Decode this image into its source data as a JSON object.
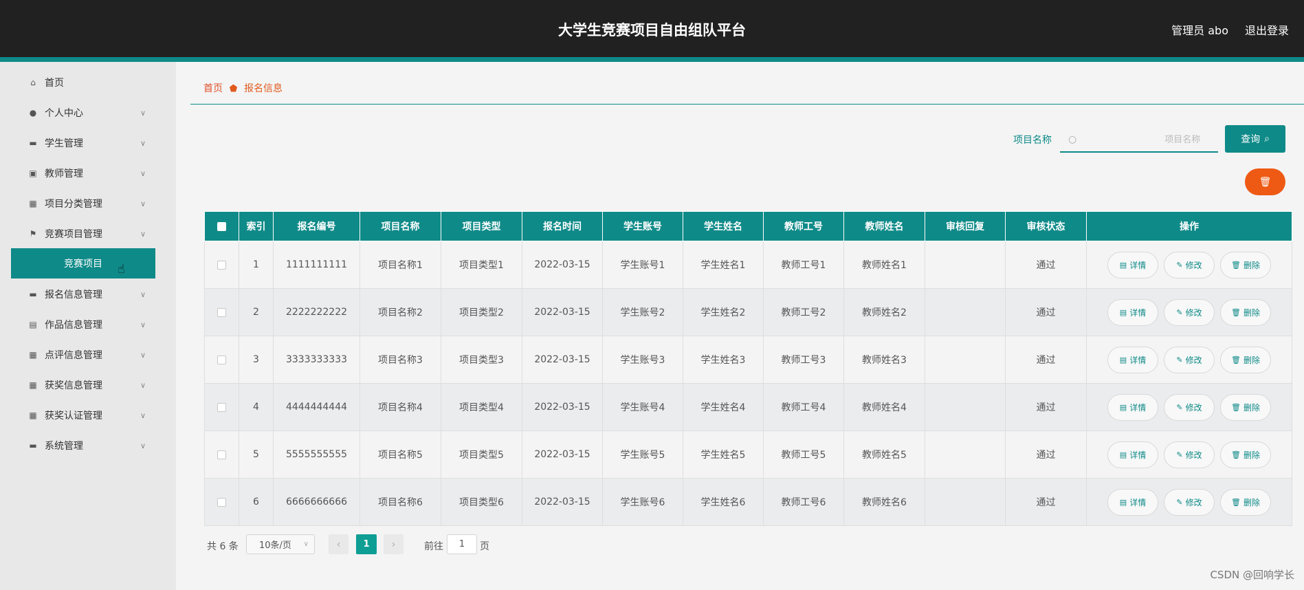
{
  "header": {
    "title": "大学生竞赛项目自由组队平台",
    "user": "管理员 abo",
    "logout": "退出登录"
  },
  "sidebar": {
    "items": [
      {
        "label": "首页",
        "icon": "home-icon",
        "glyph": "⌂",
        "arrow": false
      },
      {
        "label": "个人中心",
        "icon": "user-icon",
        "glyph": "●",
        "arrow": true
      },
      {
        "label": "学生管理",
        "icon": "briefcase-icon",
        "glyph": "▬",
        "arrow": true
      },
      {
        "label": "教师管理",
        "icon": "clipboard-icon",
        "glyph": "▣",
        "arrow": true
      },
      {
        "label": "项目分类管理",
        "icon": "grid-icon",
        "glyph": "▦",
        "arrow": true
      },
      {
        "label": "竞赛项目管理",
        "icon": "flag-icon",
        "glyph": "⚑",
        "arrow": true
      },
      {
        "label": "报名信息管理",
        "icon": "ticket-icon",
        "glyph": "▬",
        "arrow": true
      },
      {
        "label": "作品信息管理",
        "icon": "document-icon",
        "glyph": "▤",
        "arrow": true
      },
      {
        "label": "点评信息管理",
        "icon": "grid-icon",
        "glyph": "▦",
        "arrow": true
      },
      {
        "label": "获奖信息管理",
        "icon": "grid-icon",
        "glyph": "▦",
        "arrow": true
      },
      {
        "label": "获奖认证管理",
        "icon": "apps-icon",
        "glyph": "▦",
        "arrow": true
      },
      {
        "label": "系统管理",
        "icon": "monitor-icon",
        "glyph": "▬",
        "arrow": true
      }
    ],
    "active_sub": "竞赛项目"
  },
  "breadcrumb": {
    "home": "首页",
    "current": "报名信息"
  },
  "search": {
    "label": "项目名称",
    "placeholder": "项目名称",
    "button": "查询"
  },
  "table": {
    "headers": [
      "索引",
      "报名编号",
      "项目名称",
      "项目类型",
      "报名时间",
      "学生账号",
      "学生姓名",
      "教师工号",
      "教师姓名",
      "审核回复",
      "审核状态",
      "操作"
    ],
    "rows": [
      [
        "1",
        "1111111111",
        "项目名称1",
        "项目类型1",
        "2022-03-15",
        "学生账号1",
        "学生姓名1",
        "教师工号1",
        "教师姓名1",
        "",
        "通过"
      ],
      [
        "2",
        "2222222222",
        "项目名称2",
        "项目类型2",
        "2022-03-15",
        "学生账号2",
        "学生姓名2",
        "教师工号2",
        "教师姓名2",
        "",
        "通过"
      ],
      [
        "3",
        "3333333333",
        "项目名称3",
        "项目类型3",
        "2022-03-15",
        "学生账号3",
        "学生姓名3",
        "教师工号3",
        "教师姓名3",
        "",
        "通过"
      ],
      [
        "4",
        "4444444444",
        "项目名称4",
        "项目类型4",
        "2022-03-15",
        "学生账号4",
        "学生姓名4",
        "教师工号4",
        "教师姓名4",
        "",
        "通过"
      ],
      [
        "5",
        "5555555555",
        "项目名称5",
        "项目类型5",
        "2022-03-15",
        "学生账号5",
        "学生姓名5",
        "教师工号5",
        "教师姓名5",
        "",
        "通过"
      ],
      [
        "6",
        "6666666666",
        "项目名称6",
        "项目类型6",
        "2022-03-15",
        "学生账号6",
        "学生姓名6",
        "教师工号6",
        "教师姓名6",
        "",
        "通过"
      ]
    ],
    "actions": {
      "detail": "详情",
      "edit": "修改",
      "delete": "删除"
    }
  },
  "pagination": {
    "total": "共 6 条",
    "page_size": "10条/页",
    "current": "1",
    "goto_prefix": "前往",
    "goto_value": "1",
    "goto_suffix": "页"
  },
  "watermark": "CSDN @回响学长",
  "colors": {
    "accent": "#0e8a88",
    "header_bg": "#212121",
    "danger": "#ee5a14"
  }
}
